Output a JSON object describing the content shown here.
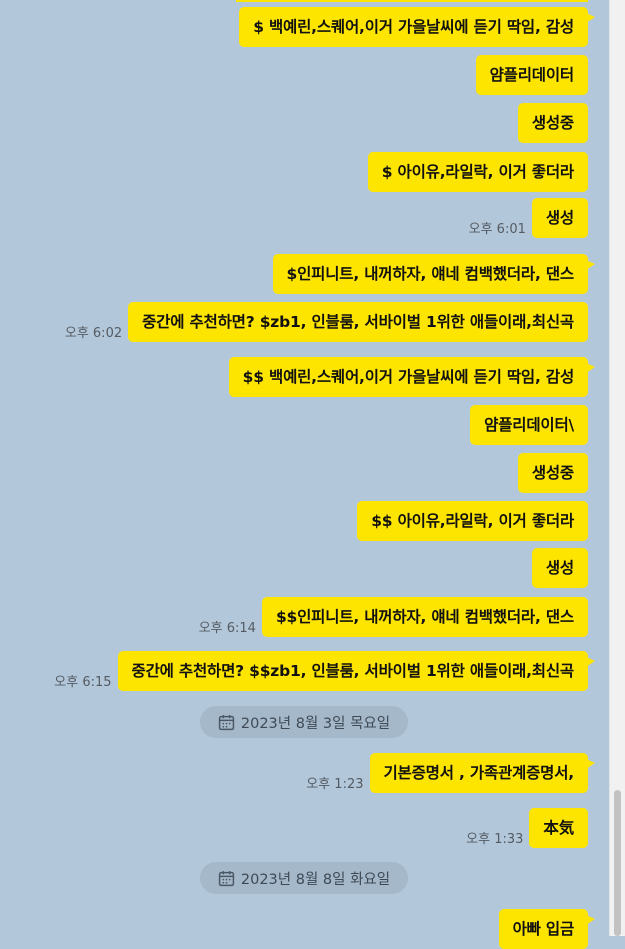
{
  "messages": [
    {
      "text": "$ 백예린,스퀘어,이거 가을날씨에 듣기 딱임, 감성",
      "time": "",
      "tail": true
    },
    {
      "text": "얌플리데이터",
      "time": "",
      "tail": false
    },
    {
      "text": "생성중",
      "time": "",
      "tail": false
    },
    {
      "text": "$ 아이유,라일락, 이거 좋더라",
      "time": "",
      "tail": false
    },
    {
      "text": "생성",
      "time": "오후 6:01",
      "tail": false
    },
    {
      "text": "$인피니트, 내꺼하자, 얘네 컴백했더라, 댄스",
      "time": "",
      "tail": true
    },
    {
      "text": "중간에 추천하면? $zb1, 인블룸, 서바이벌 1위한 애들이래,최신곡",
      "time": "오후 6:02",
      "tail": false
    },
    {
      "text": "$$ 백예린,스퀘어,이거 가을날씨에 듣기 딱임, 감성",
      "time": "",
      "tail": true
    },
    {
      "text": "얌플리데이터\\",
      "time": "",
      "tail": false
    },
    {
      "text": "생성중",
      "time": "",
      "tail": false
    },
    {
      "text": "$$ 아이유,라일락, 이거 좋더라",
      "time": "",
      "tail": false
    },
    {
      "text": "생성",
      "time": "",
      "tail": false
    },
    {
      "text": "$$인피니트, 내꺼하자, 얘네 컴백했더라, 댄스",
      "time": "오후 6:14",
      "tail": false
    },
    {
      "text": "중간에 추천하면? $$zb1, 인블룸, 서바이벌 1위한 애들이래,최신곡",
      "time": "오후 6:15",
      "tail": true
    },
    {
      "text": "기본증명서 , 가족관계증명서,",
      "time": "오후 1:23",
      "tail": true
    },
    {
      "text": "本気",
      "time": "오후 1:33",
      "tail": false
    },
    {
      "text": "아빠 입금",
      "time": "",
      "tail": true
    }
  ],
  "date_separators": [
    {
      "label": "2023년 8월 3일 목요일",
      "icon": "calendar-icon"
    },
    {
      "label": "2023년 8월 8일 화요일",
      "icon": "calendar-icon"
    }
  ],
  "colors": {
    "background": "#b2c7d9",
    "bubble": "#fee500",
    "date_pill": "#a5b8c9"
  }
}
